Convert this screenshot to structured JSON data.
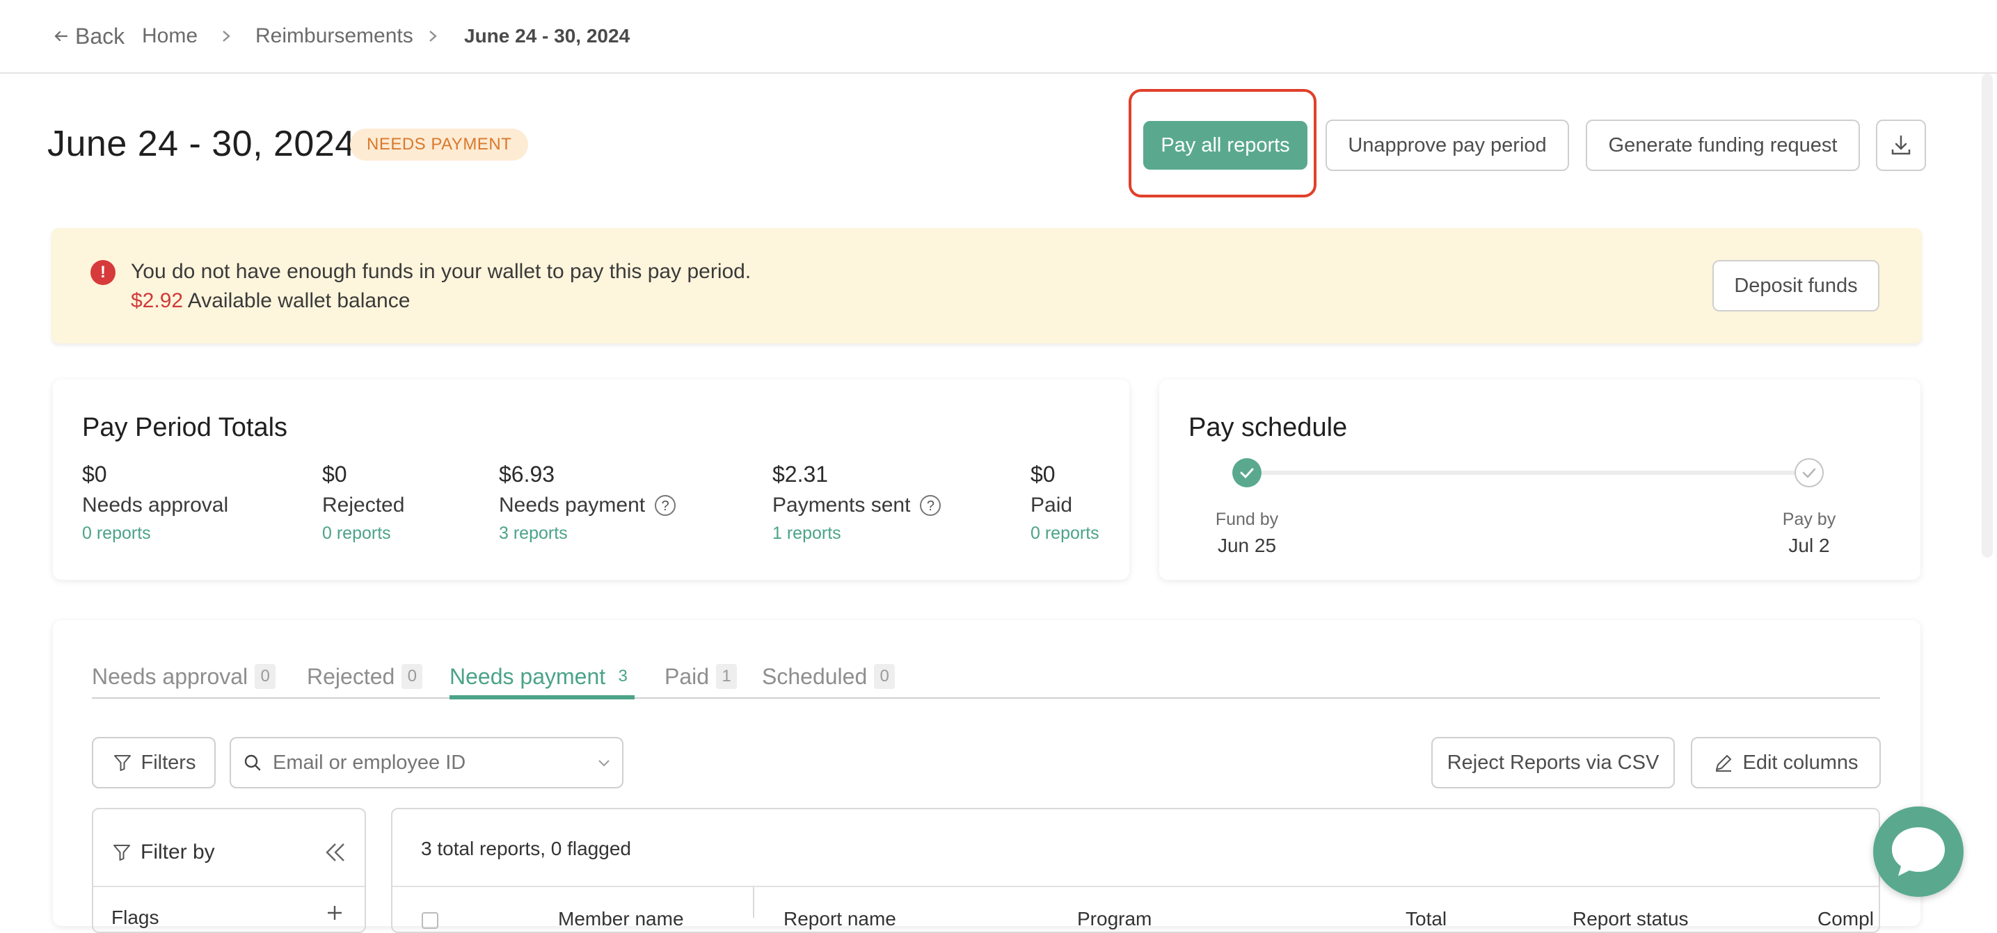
{
  "nav": {
    "back_label": "Back",
    "breadcrumb": [
      "Home",
      "Reimbursements",
      "June 24 - 30, 2024"
    ]
  },
  "header": {
    "title": "June 24 - 30, 2024",
    "status_badge": "NEEDS PAYMENT",
    "buttons": {
      "pay_all": "Pay all reports",
      "unapprove": "Unapprove pay period",
      "generate_funding": "Generate funding request"
    }
  },
  "alert": {
    "message": "You do not have enough funds in your wallet to pay this pay period.",
    "balance_amount": "$2.92",
    "balance_label": "Available wallet balance",
    "deposit_label": "Deposit funds"
  },
  "totals": {
    "title": "Pay Period Totals",
    "items": [
      {
        "amount": "$0",
        "label": "Needs approval",
        "reports": "0 reports",
        "help": false
      },
      {
        "amount": "$0",
        "label": "Rejected",
        "reports": "0 reports",
        "help": false
      },
      {
        "amount": "$6.93",
        "label": "Needs payment",
        "reports": "3 reports",
        "help": true
      },
      {
        "amount": "$2.31",
        "label": "Payments sent",
        "reports": "1 reports",
        "help": true
      },
      {
        "amount": "$0",
        "label": "Paid",
        "reports": "0 reports",
        "help": false
      }
    ]
  },
  "schedule": {
    "title": "Pay schedule",
    "fund_label": "Fund by",
    "fund_date": "Jun 25",
    "pay_label": "Pay by",
    "pay_date": "Jul 2"
  },
  "tabs": [
    {
      "label": "Needs approval",
      "count": "0"
    },
    {
      "label": "Rejected",
      "count": "0"
    },
    {
      "label": "Needs payment",
      "count": "3"
    },
    {
      "label": "Paid",
      "count": "1"
    },
    {
      "label": "Scheduled",
      "count": "0"
    }
  ],
  "toolbar": {
    "filters_label": "Filters",
    "search_placeholder": "Email or employee ID",
    "reject_csv_label": "Reject Reports via CSV",
    "edit_columns_label": "Edit columns"
  },
  "filter_panel": {
    "title": "Filter by",
    "first_section": "Flags"
  },
  "table": {
    "summary": "3 total reports, 0 flagged",
    "columns": [
      "Member name",
      "Report name",
      "Program",
      "Total",
      "Report status",
      "Compl"
    ]
  },
  "colors": {
    "accent": "#5aa98f",
    "alert_bg": "#fdf5dc",
    "badge_bg": "#fdebd3",
    "badge_text": "#d8792d",
    "error": "#cf3a3a",
    "highlight": "#e0402a"
  }
}
